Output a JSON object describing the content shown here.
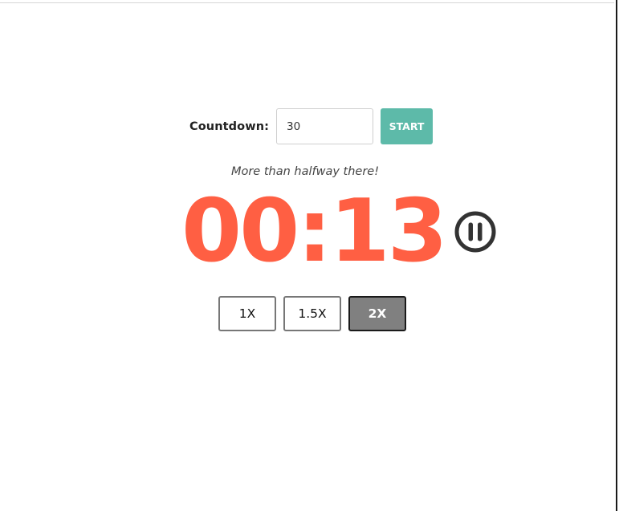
{
  "countdown": {
    "label": "Countdown:",
    "input_value": "30",
    "start_label": "START"
  },
  "status_message": "More than halfway there!",
  "timer": {
    "display": "00:13",
    "color": "#ff5f43",
    "state": "running",
    "control_icon": "pause-circle-icon"
  },
  "speeds": [
    {
      "label": "1X",
      "active": false
    },
    {
      "label": "1.5X",
      "active": false
    },
    {
      "label": "2X",
      "active": true
    }
  ],
  "colors": {
    "start_button": "#5dbaa9",
    "active_speed": "#808080",
    "pause_icon": "#333333"
  }
}
